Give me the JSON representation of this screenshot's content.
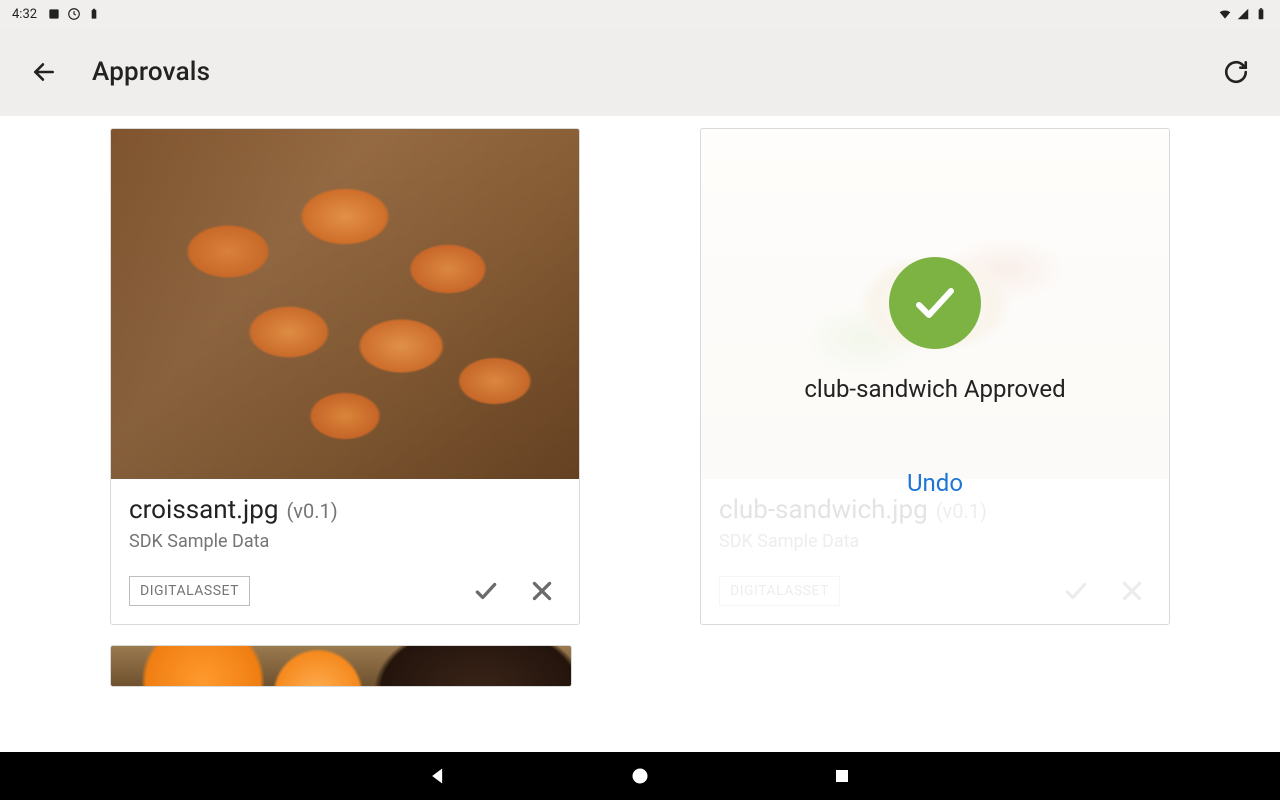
{
  "status": {
    "time": "4:32"
  },
  "header": {
    "title": "Approvals"
  },
  "icons": {
    "back": "back-icon",
    "refresh": "refresh-icon",
    "check": "check-icon",
    "close": "close-icon",
    "circle_check": "approved-check-icon"
  },
  "cards": [
    {
      "filename": "croissant.jpg",
      "version": "(v0.1)",
      "subtitle": "SDK Sample Data",
      "tag": "DIGITALASSET",
      "state": "pending",
      "image": "croissant"
    },
    {
      "filename": "club-sandwich.jpg",
      "version": "(v0.1)",
      "subtitle": "SDK Sample Data",
      "tag": "DIGITALASSET",
      "state": "approved",
      "image": "sandwich",
      "overlay_text": "club-sandwich Approved",
      "undo_label": "Undo"
    }
  ],
  "colors": {
    "accent_green": "#7cb342",
    "link_blue": "#1e76d2"
  },
  "navbar": {
    "back": "nav-back",
    "home": "nav-home",
    "recent": "nav-recent"
  }
}
